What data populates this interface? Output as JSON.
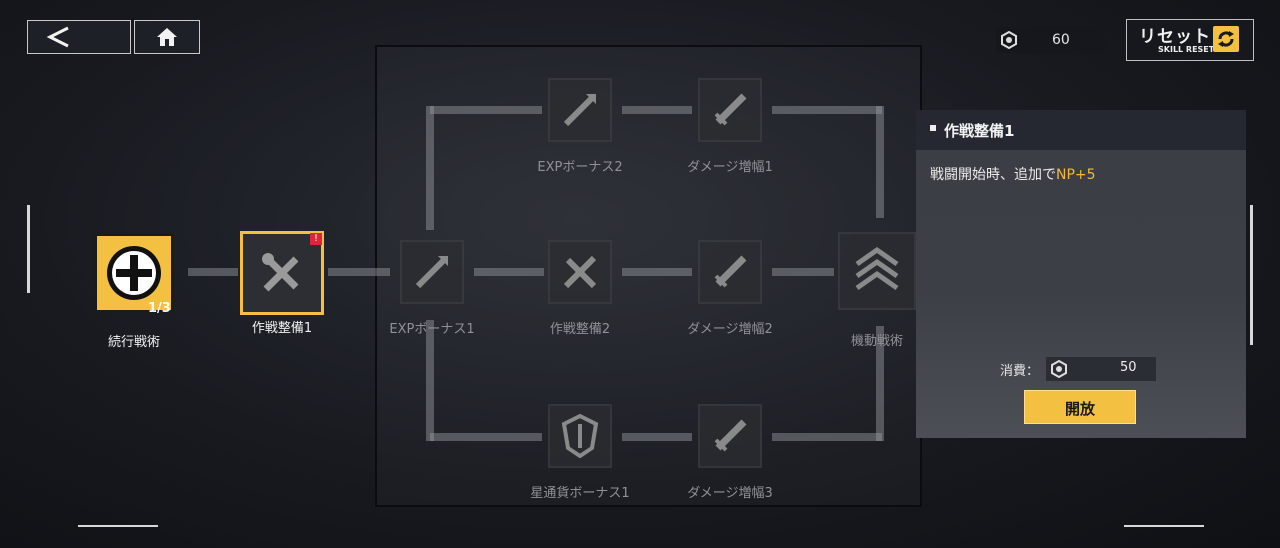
{
  "top_bar": {
    "back_icon": "back-chevron-icon",
    "home_icon": "home-icon",
    "currency_icon": "hex-gear-icon",
    "currency_value": "60",
    "reset_label": "リセット",
    "reset_sub": "SKILL RESET",
    "reset_icon": "refresh-icon"
  },
  "root": {
    "label": "続行戦術",
    "level": "1/3"
  },
  "nodes": {
    "selected": "作戦整備1",
    "exp1": "EXPボーナス1",
    "exp2": "EXPボーナス2",
    "prep2": "作戦整備2",
    "dmg1": "ダメージ増幅1",
    "dmg2": "ダメージ増幅2",
    "dmg3": "ダメージ増幅3",
    "mobile": "機動戦術",
    "star": "星通貨ボーナス1"
  },
  "info": {
    "title": "作戦整備1",
    "desc_prefix": "戦闘開始時、追加で",
    "desc_highlight": "NP+5",
    "cost_label": "消費：",
    "cost_value": "50",
    "open_label": "開放"
  },
  "colors": {
    "accent": "#f3c042",
    "highlight_text": "#f4b93a",
    "alert": "#e0223a"
  }
}
